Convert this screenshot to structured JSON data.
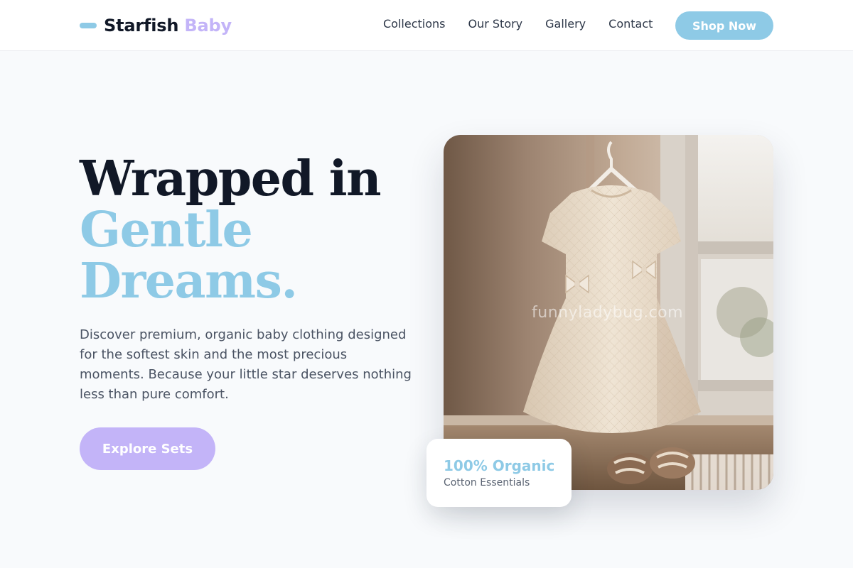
{
  "brand": {
    "name": "Starfish",
    "accent": "Baby",
    "accent_color": "#c3b4f8",
    "primary_color": "#8ecae6"
  },
  "nav": {
    "links": [
      "Collections",
      "Our Story",
      "Gallery",
      "Contact"
    ],
    "cta": "Shop Now"
  },
  "hero": {
    "title_line_1": "Wrapped in",
    "title_line_2": "Gentle",
    "title_line_3": "Dreams.",
    "description": "Discover premium, organic baby clothing designed for the softest skin and the most precious moments. Because your little star deserves nothing less than pure comfort.",
    "cta": "Explore Sets"
  },
  "image": {
    "watermark": "funnyladybug.com"
  },
  "badge": {
    "title": "100% Organic",
    "subtitle": "Cotton Essentials"
  }
}
